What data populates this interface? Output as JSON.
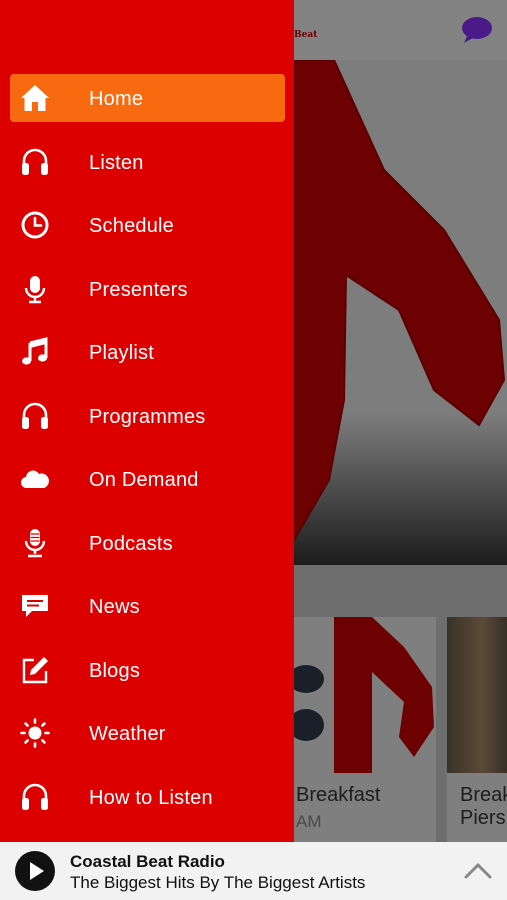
{
  "background": {
    "header_logo_fragment": "Beat",
    "cards": [
      {
        "title": "Breakfast",
        "subtitle": "AM"
      },
      {
        "title": "Break",
        "title_line2": "Piers"
      }
    ]
  },
  "menu": {
    "items": [
      {
        "label": "Home",
        "icon": "home-icon",
        "active": true
      },
      {
        "label": "Listen",
        "icon": "headphones-icon"
      },
      {
        "label": "Schedule",
        "icon": "clock-icon"
      },
      {
        "label": "Presenters",
        "icon": "microphone-icon"
      },
      {
        "label": "Playlist",
        "icon": "music-note-icon"
      },
      {
        "label": "Programmes",
        "icon": "headphones-icon"
      },
      {
        "label": "On Demand",
        "icon": "cloud-icon"
      },
      {
        "label": "Podcasts",
        "icon": "podcast-mic-icon"
      },
      {
        "label": "News",
        "icon": "message-icon"
      },
      {
        "label": "Blogs",
        "icon": "edit-icon"
      },
      {
        "label": "Weather",
        "icon": "sun-icon"
      },
      {
        "label": "How to Listen",
        "icon": "headphones-icon"
      }
    ]
  },
  "player": {
    "station_name": "Coastal Beat Radio",
    "tagline": "The Biggest Hits By The Biggest Artists"
  },
  "colors": {
    "drawer": "#dd0000",
    "active_item": "#f76a0f",
    "player_bg": "#f2f2f2"
  }
}
